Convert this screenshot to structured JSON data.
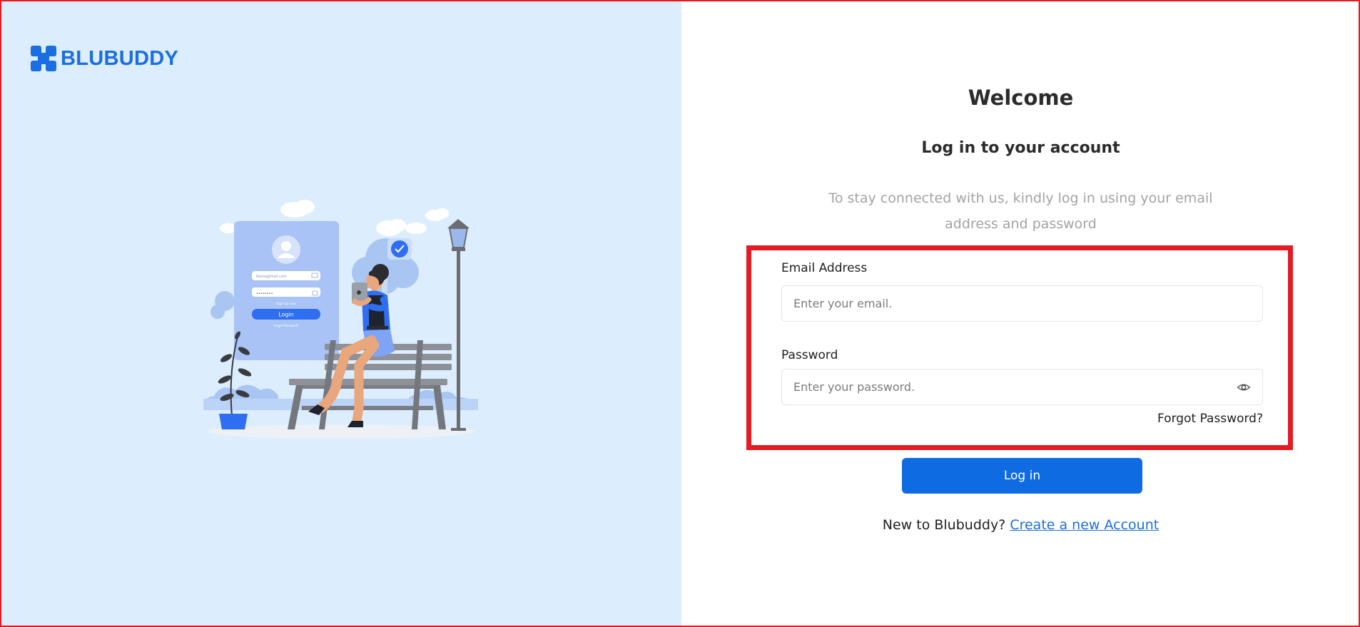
{
  "brand": {
    "name": "BLUBUDDY",
    "color": "#1a6ee2"
  },
  "illustration": {
    "mini_form": {
      "email_text": "Name@mail.com",
      "password_text": "••••••••",
      "signup_text": "Sign up now",
      "button_label": "Login",
      "forgot_text": "Forgot Password?"
    }
  },
  "login": {
    "title": "Welcome",
    "subtitle": "Log in to your account",
    "description": "To stay connected with us, kindly log in using your email address and password",
    "email": {
      "label": "Email Address",
      "placeholder": "Enter your email.",
      "value": ""
    },
    "password": {
      "label": "Password",
      "placeholder": "Enter your password.",
      "value": "",
      "toggle_icon": "eye-icon"
    },
    "forgot_label": "Forgot Password?",
    "submit_label": "Log in",
    "signup_prompt": "New to Blubuddy?",
    "signup_link": "Create a new Account"
  },
  "colors": {
    "accent": "#0f6be2",
    "left_background": "#dcedfd",
    "highlight": "#e31b23"
  }
}
